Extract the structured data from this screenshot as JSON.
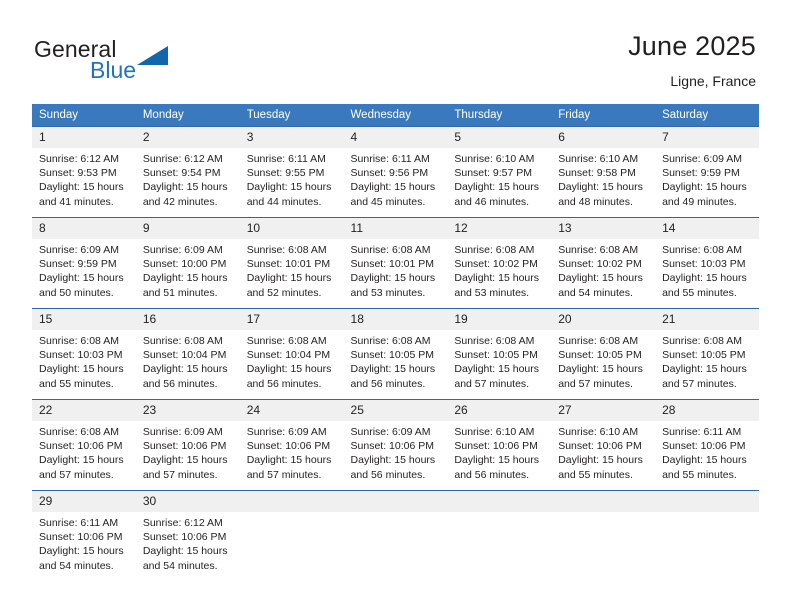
{
  "brand": {
    "word_one": "General",
    "word_two": "Blue",
    "logo_icon": "triangle-logo-icon",
    "accent_color": "#1266ab"
  },
  "header": {
    "title": "June 2025",
    "subtitle": "Ligne, France"
  },
  "theme": {
    "header_blue": "#3b79bf",
    "rule_blue": "#2b6aa8",
    "daynum_band": "#f0f0f0"
  },
  "calendar": {
    "weekday_headers": [
      "Sunday",
      "Monday",
      "Tuesday",
      "Wednesday",
      "Thursday",
      "Friday",
      "Saturday"
    ],
    "labels": {
      "sunrise": "Sunrise:",
      "sunset": "Sunset:",
      "daylight": "Daylight:"
    },
    "weeks": [
      [
        {
          "day": "1",
          "sunrise": "Sunrise: 6:12 AM",
          "sunset": "Sunset: 9:53 PM",
          "daylight_line1": "Daylight: 15 hours",
          "daylight_line2": "and 41 minutes."
        },
        {
          "day": "2",
          "sunrise": "Sunrise: 6:12 AM",
          "sunset": "Sunset: 9:54 PM",
          "daylight_line1": "Daylight: 15 hours",
          "daylight_line2": "and 42 minutes."
        },
        {
          "day": "3",
          "sunrise": "Sunrise: 6:11 AM",
          "sunset": "Sunset: 9:55 PM",
          "daylight_line1": "Daylight: 15 hours",
          "daylight_line2": "and 44 minutes."
        },
        {
          "day": "4",
          "sunrise": "Sunrise: 6:11 AM",
          "sunset": "Sunset: 9:56 PM",
          "daylight_line1": "Daylight: 15 hours",
          "daylight_line2": "and 45 minutes."
        },
        {
          "day": "5",
          "sunrise": "Sunrise: 6:10 AM",
          "sunset": "Sunset: 9:57 PM",
          "daylight_line1": "Daylight: 15 hours",
          "daylight_line2": "and 46 minutes."
        },
        {
          "day": "6",
          "sunrise": "Sunrise: 6:10 AM",
          "sunset": "Sunset: 9:58 PM",
          "daylight_line1": "Daylight: 15 hours",
          "daylight_line2": "and 48 minutes."
        },
        {
          "day": "7",
          "sunrise": "Sunrise: 6:09 AM",
          "sunset": "Sunset: 9:59 PM",
          "daylight_line1": "Daylight: 15 hours",
          "daylight_line2": "and 49 minutes."
        }
      ],
      [
        {
          "day": "8",
          "sunrise": "Sunrise: 6:09 AM",
          "sunset": "Sunset: 9:59 PM",
          "daylight_line1": "Daylight: 15 hours",
          "daylight_line2": "and 50 minutes."
        },
        {
          "day": "9",
          "sunrise": "Sunrise: 6:09 AM",
          "sunset": "Sunset: 10:00 PM",
          "daylight_line1": "Daylight: 15 hours",
          "daylight_line2": "and 51 minutes."
        },
        {
          "day": "10",
          "sunrise": "Sunrise: 6:08 AM",
          "sunset": "Sunset: 10:01 PM",
          "daylight_line1": "Daylight: 15 hours",
          "daylight_line2": "and 52 minutes."
        },
        {
          "day": "11",
          "sunrise": "Sunrise: 6:08 AM",
          "sunset": "Sunset: 10:01 PM",
          "daylight_line1": "Daylight: 15 hours",
          "daylight_line2": "and 53 minutes."
        },
        {
          "day": "12",
          "sunrise": "Sunrise: 6:08 AM",
          "sunset": "Sunset: 10:02 PM",
          "daylight_line1": "Daylight: 15 hours",
          "daylight_line2": "and 53 minutes."
        },
        {
          "day": "13",
          "sunrise": "Sunrise: 6:08 AM",
          "sunset": "Sunset: 10:02 PM",
          "daylight_line1": "Daylight: 15 hours",
          "daylight_line2": "and 54 minutes."
        },
        {
          "day": "14",
          "sunrise": "Sunrise: 6:08 AM",
          "sunset": "Sunset: 10:03 PM",
          "daylight_line1": "Daylight: 15 hours",
          "daylight_line2": "and 55 minutes."
        }
      ],
      [
        {
          "day": "15",
          "sunrise": "Sunrise: 6:08 AM",
          "sunset": "Sunset: 10:03 PM",
          "daylight_line1": "Daylight: 15 hours",
          "daylight_line2": "and 55 minutes."
        },
        {
          "day": "16",
          "sunrise": "Sunrise: 6:08 AM",
          "sunset": "Sunset: 10:04 PM",
          "daylight_line1": "Daylight: 15 hours",
          "daylight_line2": "and 56 minutes."
        },
        {
          "day": "17",
          "sunrise": "Sunrise: 6:08 AM",
          "sunset": "Sunset: 10:04 PM",
          "daylight_line1": "Daylight: 15 hours",
          "daylight_line2": "and 56 minutes."
        },
        {
          "day": "18",
          "sunrise": "Sunrise: 6:08 AM",
          "sunset": "Sunset: 10:05 PM",
          "daylight_line1": "Daylight: 15 hours",
          "daylight_line2": "and 56 minutes."
        },
        {
          "day": "19",
          "sunrise": "Sunrise: 6:08 AM",
          "sunset": "Sunset: 10:05 PM",
          "daylight_line1": "Daylight: 15 hours",
          "daylight_line2": "and 57 minutes."
        },
        {
          "day": "20",
          "sunrise": "Sunrise: 6:08 AM",
          "sunset": "Sunset: 10:05 PM",
          "daylight_line1": "Daylight: 15 hours",
          "daylight_line2": "and 57 minutes."
        },
        {
          "day": "21",
          "sunrise": "Sunrise: 6:08 AM",
          "sunset": "Sunset: 10:05 PM",
          "daylight_line1": "Daylight: 15 hours",
          "daylight_line2": "and 57 minutes."
        }
      ],
      [
        {
          "day": "22",
          "sunrise": "Sunrise: 6:08 AM",
          "sunset": "Sunset: 10:06 PM",
          "daylight_line1": "Daylight: 15 hours",
          "daylight_line2": "and 57 minutes."
        },
        {
          "day": "23",
          "sunrise": "Sunrise: 6:09 AM",
          "sunset": "Sunset: 10:06 PM",
          "daylight_line1": "Daylight: 15 hours",
          "daylight_line2": "and 57 minutes."
        },
        {
          "day": "24",
          "sunrise": "Sunrise: 6:09 AM",
          "sunset": "Sunset: 10:06 PM",
          "daylight_line1": "Daylight: 15 hours",
          "daylight_line2": "and 57 minutes."
        },
        {
          "day": "25",
          "sunrise": "Sunrise: 6:09 AM",
          "sunset": "Sunset: 10:06 PM",
          "daylight_line1": "Daylight: 15 hours",
          "daylight_line2": "and 56 minutes."
        },
        {
          "day": "26",
          "sunrise": "Sunrise: 6:10 AM",
          "sunset": "Sunset: 10:06 PM",
          "daylight_line1": "Daylight: 15 hours",
          "daylight_line2": "and 56 minutes."
        },
        {
          "day": "27",
          "sunrise": "Sunrise: 6:10 AM",
          "sunset": "Sunset: 10:06 PM",
          "daylight_line1": "Daylight: 15 hours",
          "daylight_line2": "and 55 minutes."
        },
        {
          "day": "28",
          "sunrise": "Sunrise: 6:11 AM",
          "sunset": "Sunset: 10:06 PM",
          "daylight_line1": "Daylight: 15 hours",
          "daylight_line2": "and 55 minutes."
        }
      ],
      [
        {
          "day": "29",
          "sunrise": "Sunrise: 6:11 AM",
          "sunset": "Sunset: 10:06 PM",
          "daylight_line1": "Daylight: 15 hours",
          "daylight_line2": "and 54 minutes."
        },
        {
          "day": "30",
          "sunrise": "Sunrise: 6:12 AM",
          "sunset": "Sunset: 10:06 PM",
          "daylight_line1": "Daylight: 15 hours",
          "daylight_line2": "and 54 minutes."
        },
        {
          "day": "",
          "sunrise": "",
          "sunset": "",
          "daylight_line1": "",
          "daylight_line2": ""
        },
        {
          "day": "",
          "sunrise": "",
          "sunset": "",
          "daylight_line1": "",
          "daylight_line2": ""
        },
        {
          "day": "",
          "sunrise": "",
          "sunset": "",
          "daylight_line1": "",
          "daylight_line2": ""
        },
        {
          "day": "",
          "sunrise": "",
          "sunset": "",
          "daylight_line1": "",
          "daylight_line2": ""
        },
        {
          "day": "",
          "sunrise": "",
          "sunset": "",
          "daylight_line1": "",
          "daylight_line2": ""
        }
      ]
    ]
  }
}
